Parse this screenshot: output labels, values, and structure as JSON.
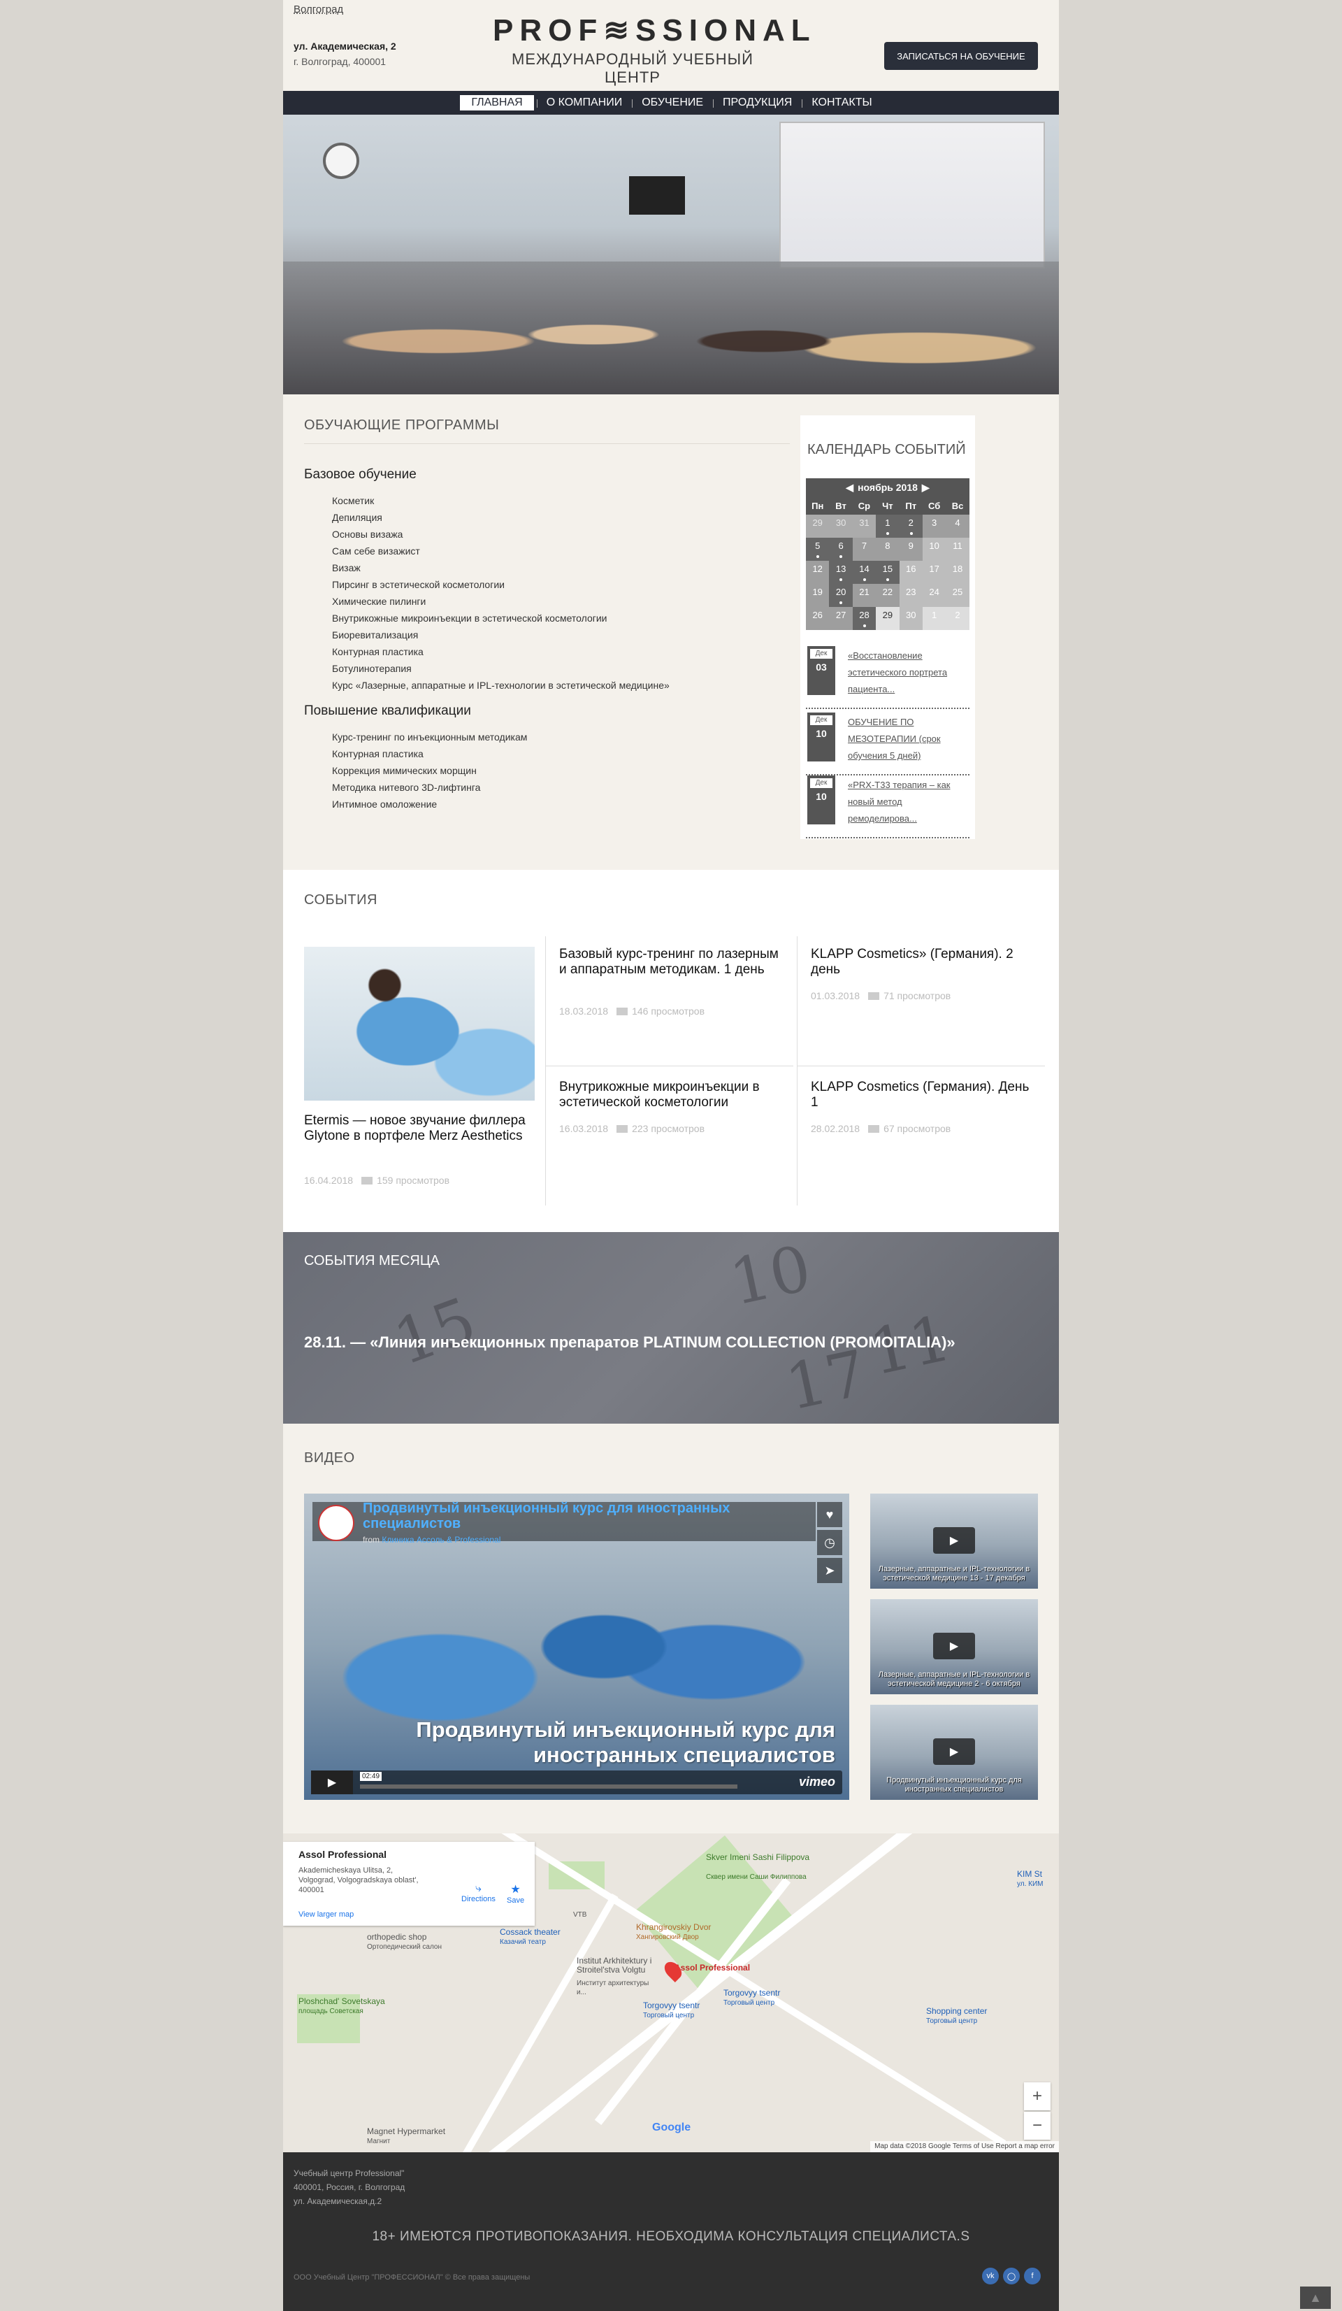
{
  "header": {
    "city": "Волгоград",
    "address_line1": "ул. Академическая, 2",
    "address_line2": "г. Волгоград, 400001",
    "logo_line1": "PROF≋SSIONAL",
    "logo_line2": "МЕЖДУНАРОДНЫЙ УЧЕБНЫЙ ЦЕНТР",
    "enroll_label": "ЗАПИСАТЬСЯ НА ОБУЧЕНИЕ"
  },
  "nav": {
    "items": [
      "ГЛАВНАЯ",
      "О КОМПАНИИ",
      "ОБУЧЕНИЕ",
      "ПРОДУКЦИЯ",
      "КОНТАКТЫ"
    ]
  },
  "programs": {
    "title": "ОБУЧАЮЩИЕ ПРОГРАММЫ",
    "basic_title": "Базовое обучение",
    "basic": [
      "Косметик",
      "Депиляция",
      "Основы визажа",
      "Сам себе визажист",
      "Визаж",
      "Пирсинг в эстетической косметологии",
      "Химические пилинги",
      "Внутрикожные микроинъекции в эстетической косметологии",
      "Биоревитализация",
      "Контурная пластика",
      "Ботулинотерапия",
      "Курс «Лазерные, аппаратные и IPL-технологии в эстетической медицине»"
    ],
    "advanced_title": "Повышение квалификации",
    "advanced": [
      "Курс-тренинг по инъекционным методикам",
      "Контурная пластика",
      "Коррекция мимических морщин",
      "Методика нитевого 3D-лифтинга",
      "Интимное омоложение"
    ]
  },
  "calendar": {
    "title": "КАЛЕНДАРЬ СОБЫТИЙ",
    "prev_icon": "arrow-left-icon",
    "next_icon": "arrow-right-icon",
    "month": "ноябрь 2018",
    "weekdays": [
      "Пн",
      "Вт",
      "Ср",
      "Чт",
      "Пт",
      "Сб",
      "Вс"
    ],
    "weeks": [
      [
        "29",
        "30",
        "31",
        "1",
        "2",
        "3",
        "4"
      ],
      [
        "5",
        "6",
        "7",
        "8",
        "9",
        "10",
        "11"
      ],
      [
        "12",
        "13",
        "14",
        "15",
        "16",
        "17",
        "18"
      ],
      [
        "19",
        "20",
        "21",
        "22",
        "23",
        "24",
        "25"
      ],
      [
        "26",
        "27",
        "28",
        "29",
        "30",
        "1",
        "2"
      ]
    ],
    "events": [
      {
        "month": "Дек",
        "day": "03",
        "text": "«Восстановление эстетического портрета пациента..."
      },
      {
        "month": "Дек",
        "day": "10",
        "text": "ОБУЧЕНИЕ ПО МЕЗОТЕРАПИИ (срок обучения 5 дней)"
      },
      {
        "month": "Дек",
        "day": "10",
        "text": "«PRX-T33 терапия – как новый метод ремоделирова..."
      }
    ]
  },
  "events": {
    "title": "СОБЫТИЯ",
    "items": [
      {
        "title": "Etermis — новое звучание филлера Glytone в портфеле Merz Aesthetics",
        "date": "16.04.2018",
        "views": "159 просмотров"
      },
      {
        "title": "Базовый курс-тренинг по лазерным и аппаратным методикам. 1 день",
        "date": "18.03.2018",
        "views": "146 просмотров"
      },
      {
        "title": "KLAPP Cosmetics» (Германия). 2 день",
        "date": "01.03.2018",
        "views": "71 просмотров"
      },
      {
        "title": "Внутрикожные микроинъекции в эстетической косметологии",
        "date": "16.03.2018",
        "views": "223 просмотров"
      },
      {
        "title": "KLAPP Cosmetics (Германия). День 1",
        "date": "28.02.2018",
        "views": "67 просмотров"
      }
    ]
  },
  "month_events": {
    "title": "СОБЫТИЯ МЕСЯЦА",
    "item": "28.11. — «Линия инъекционных препаратов PLATINUM COLLECTION (PROMOITALIA)»"
  },
  "video": {
    "title": "ВИДЕО",
    "main_title": "Продвинутый инъекционный курс для иностранных специалистов",
    "from_label": "from",
    "from_author": "Клиника Ассоль & Professional",
    "caption": "Продвинутый инъекционный курс для иностранных специалистов",
    "time": "02:49",
    "vimeo": "vimeo",
    "thumbs": [
      {
        "caption": "Лазерные, аппаратные и IPL-технологии в эстетической медицине 13 - 17 декабря"
      },
      {
        "caption": "Лазерные, аппаратные и IPL-технологии в эстетической медицине 2 - 6 октября"
      },
      {
        "caption": "Продвинутый инъекционный курс для иностранных специалистов"
      }
    ]
  },
  "map": {
    "place_name": "Assol Professional",
    "place_address": "Akademicheskaya Ulitsa, 2, Volgograd, Volgogradskaya oblast', 400001",
    "directions": "Directions",
    "save": "Save",
    "view_larger": "View larger map",
    "labels": {
      "skver": "Skver Imeni Sashi Filippova",
      "skver_ru": "Сквер имени Саши Филиппова",
      "khram": "Khrangirovskiy Dvor",
      "khram_ru": "Хангировский Двор",
      "institute": "Institut Arkhitektury i Stroitel'stva Volgtu",
      "institute_ru": "Институт архитектуры и...",
      "torgovyy1": "Torgovyy tsentr",
      "torgovyy1_ru": "Торговый центр",
      "torgovyy2": "Torgovyy tsentr",
      "torgovyy2_ru": "Торговый центр",
      "shopping": "Shopping center",
      "shopping_ru": "Торговый центр",
      "ortho": "orthopedic shop",
      "ortho_ru": "Ортопедический салон",
      "cossack": "Cossack theater",
      "cossack_ru": "Казачий театр",
      "ploshchad": "Ploshchad' Sovetskaya",
      "ploshchad_ru": "площадь Советская",
      "magnet": "Magnet Hypermarket",
      "magnet_ru": "Магнит",
      "pin_label": "Assol Professional",
      "kim": "KIM St",
      "kim_ru": "ул. КИМ",
      "vtb": "VTB"
    },
    "google": "Google",
    "footer": "Map data ©2018 Google   Terms of Use   Report a map error"
  },
  "footer": {
    "addr1": "Учебный центр Professional\"",
    "addr2": "400001, Россия, г. Волгоград",
    "addr3": "ул. Академическая,д.2",
    "warning": "18+ ИМЕЮТСЯ ПРОТИВОПОКАЗАНИЯ. НЕОБХОДИМА КОНСУЛЬТАЦИЯ СПЕЦИАЛИСТА.S",
    "copyright": "ООО Учебный Центр \"ПРОФЕССИОНАЛ\" © Все права защищены",
    "social": [
      "vk-icon",
      "instagram-icon",
      "facebook-icon"
    ]
  },
  "colors": {
    "nav_bg": "#272b36",
    "page_bg": "#f4f1eb",
    "footer_bg": "#2f2f2f",
    "accent_link": "#1a73e8"
  }
}
